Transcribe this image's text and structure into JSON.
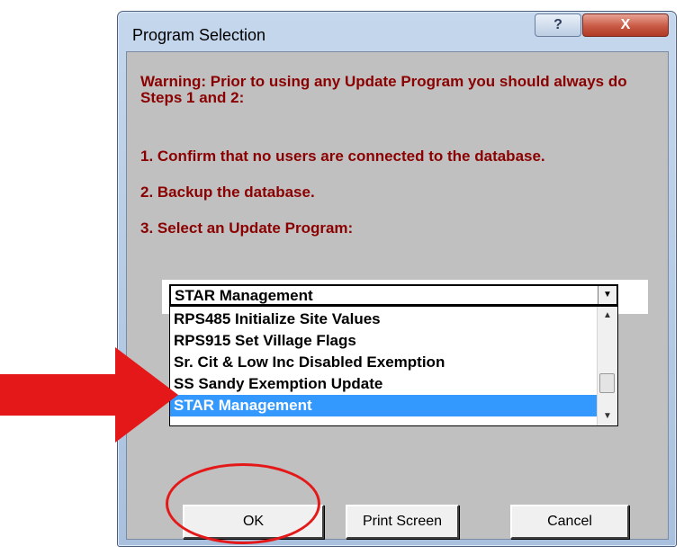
{
  "window": {
    "title": "Program Selection",
    "help_glyph": "?",
    "close_glyph": "X"
  },
  "messages": {
    "warning": "Warning: Prior to using any Update Program you should always do Steps 1 and 2:",
    "step1": "1. Confirm that no users are connected to the  database.",
    "step2": "2. Backup the database.",
    "step3": "3. Select an Update Program:"
  },
  "program_select": {
    "selected_value": "STAR Management",
    "arrow_glyph": "▼",
    "options": [
      "RPS485 Initialize Site Values",
      "RPS915 Set Village Flags",
      "Sr. Cit & Low Inc Disabled Exemption",
      "SS Sandy Exemption Update",
      "STAR Management"
    ],
    "highlighted_index": 4,
    "scroll_up_glyph": "▲",
    "scroll_down_glyph": "▼"
  },
  "buttons": {
    "ok": "OK",
    "print_screen": "Print Screen",
    "cancel": "Cancel"
  },
  "colors": {
    "message_text": "#8b0000",
    "selection_highlight": "#3399ff",
    "annotation_red": "#e41818",
    "dialog_background": "#c0c0c0"
  },
  "icons": {
    "arrow_annotation": "red-right-arrow",
    "circle_annotation": "red-ellipse-highlight"
  }
}
